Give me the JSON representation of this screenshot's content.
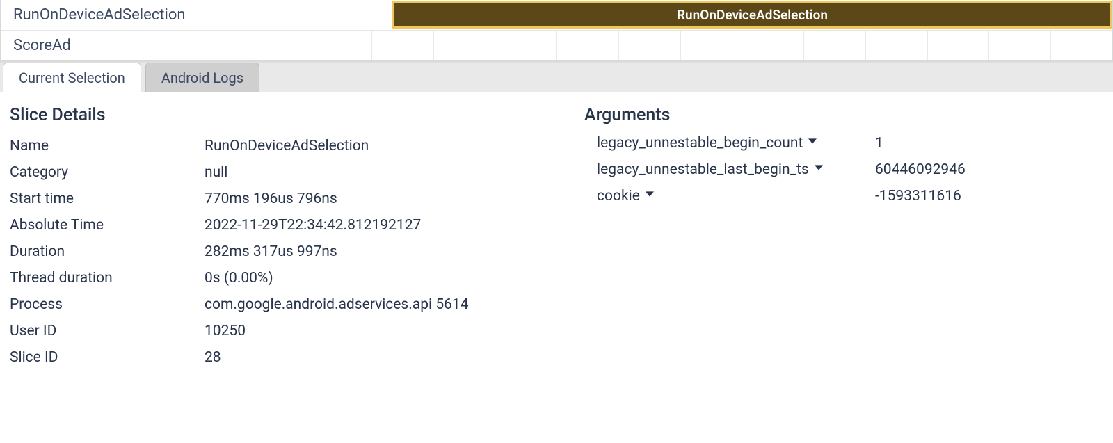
{
  "tracks": {
    "row0": {
      "label": "RunOnDeviceAdSelection",
      "slice_label": "RunOnDeviceAdSelection"
    },
    "row1": {
      "label": "ScoreAd"
    }
  },
  "tabs": {
    "current_selection": "Current Selection",
    "android_logs": "Android Logs"
  },
  "details": {
    "heading": "Slice Details",
    "rows": {
      "name": {
        "k": "Name",
        "v": "RunOnDeviceAdSelection"
      },
      "category": {
        "k": "Category",
        "v": "null"
      },
      "start_time": {
        "k": "Start time",
        "v": "770ms 196us 796ns"
      },
      "absolute_time": {
        "k": "Absolute Time",
        "v": "2022-11-29T22:34:42.812192127"
      },
      "duration": {
        "k": "Duration",
        "v": "282ms 317us 997ns"
      },
      "thread_duration": {
        "k": "Thread duration",
        "v": "0s (0.00%)"
      },
      "process": {
        "k": "Process",
        "v": "com.google.android.adservices.api 5614"
      },
      "user_id": {
        "k": "User ID",
        "v": "10250"
      },
      "slice_id": {
        "k": "Slice ID",
        "v": "28"
      }
    }
  },
  "arguments": {
    "heading": "Arguments",
    "rows": {
      "legacy_unnestable_begin_count": {
        "k": "legacy_unnestable_begin_count",
        "v": "1"
      },
      "legacy_unnestable_last_begin_ts": {
        "k": "legacy_unnestable_last_begin_ts",
        "v": "60446092946"
      },
      "cookie": {
        "k": "cookie",
        "v": "-1593311616"
      }
    }
  }
}
